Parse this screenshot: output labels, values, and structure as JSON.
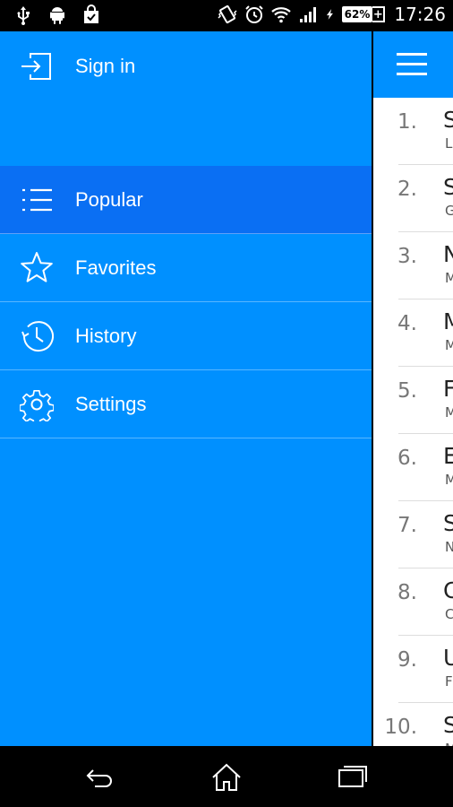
{
  "status_bar": {
    "left_icons": [
      "usb-icon",
      "android-icon",
      "shopping-bag-icon"
    ],
    "right_icons": [
      "vibrate-icon",
      "alarm-icon",
      "wifi-icon",
      "signal-icon",
      "charging-icon"
    ],
    "battery": "62%",
    "time": "17:26"
  },
  "drawer": {
    "signin_label": "Sign in",
    "items": [
      {
        "label": "Popular",
        "icon": "list-icon",
        "active": true
      },
      {
        "label": "Favorites",
        "icon": "star-icon",
        "active": false
      },
      {
        "label": "History",
        "icon": "history-icon",
        "active": false
      },
      {
        "label": "Settings",
        "icon": "gear-icon",
        "active": false
      }
    ]
  },
  "content": {
    "menu_icon": "hamburger-icon",
    "rows": [
      {
        "num": "1.",
        "title": "S",
        "sub": "L"
      },
      {
        "num": "2.",
        "title": "S",
        "sub": "G"
      },
      {
        "num": "3.",
        "title": "N",
        "sub": "M"
      },
      {
        "num": "4.",
        "title": "M",
        "sub": "M"
      },
      {
        "num": "5.",
        "title": "F",
        "sub": "M"
      },
      {
        "num": "6.",
        "title": "E",
        "sub": "M"
      },
      {
        "num": "7.",
        "title": "S",
        "sub": "N"
      },
      {
        "num": "8.",
        "title": "C",
        "sub": "C"
      },
      {
        "num": "9.",
        "title": "U",
        "sub": "F"
      },
      {
        "num": "10.",
        "title": "S",
        "sub": "M"
      }
    ]
  },
  "nav_bar": {
    "icons": [
      "back-icon",
      "home-icon",
      "recents-icon"
    ]
  },
  "colors": {
    "drawer_bg": "#0090ff",
    "active_item_bg": "#0a6ff3",
    "status_bar_bg": "#000000"
  }
}
